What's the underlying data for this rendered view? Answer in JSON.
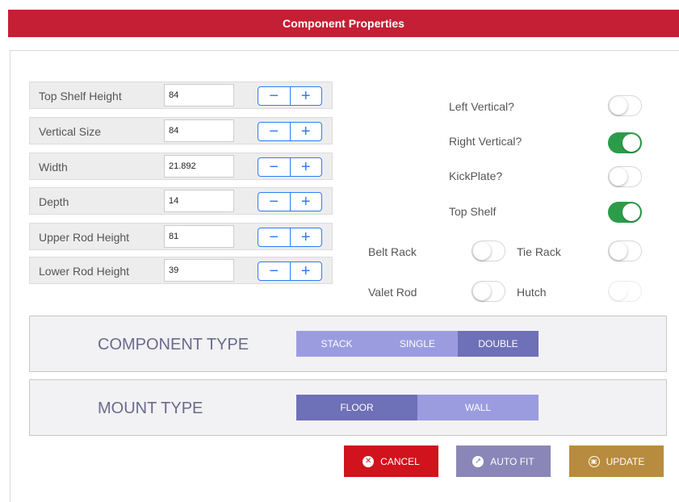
{
  "header": {
    "title": "Component Properties"
  },
  "fields": [
    {
      "label": "Top Shelf Height",
      "value": "84"
    },
    {
      "label": "Vertical Size",
      "value": "84"
    },
    {
      "label": "Width",
      "value": "21.892"
    },
    {
      "label": "Depth",
      "value": "14"
    },
    {
      "label": "Upper Rod Height",
      "value": "81"
    },
    {
      "label": "Lower Rod Height",
      "value": "39"
    }
  ],
  "stepper": {
    "minus": "−",
    "plus": "+"
  },
  "options": {
    "left_vertical": {
      "label": "Left Vertical?",
      "on": false
    },
    "right_vertical": {
      "label": "Right Vertical?",
      "on": true
    },
    "kickplate": {
      "label": "KickPlate?",
      "on": false
    },
    "top_shelf": {
      "label": "Top Shelf",
      "on": true
    },
    "belt_rack": {
      "label": "Belt Rack",
      "on": false
    },
    "tie_rack": {
      "label": "Tie Rack",
      "on": false
    },
    "valet_rod": {
      "label": "Valet Rod",
      "on": false
    },
    "hutch": {
      "label": "Hutch",
      "on": false,
      "disabled": true
    }
  },
  "component_type": {
    "title": "COMPONENT TYPE",
    "options": [
      "STACK",
      "SINGLE",
      "DOUBLE"
    ],
    "selected": "DOUBLE"
  },
  "mount_type": {
    "title": "MOUNT TYPE",
    "options": [
      "FLOOR",
      "WALL"
    ],
    "selected": "FLOOR"
  },
  "buttons": {
    "cancel": "CANCEL",
    "auto_fit": "AUTO FIT",
    "update": "UPDATE"
  },
  "colors": {
    "header": "#c41f35",
    "toggle_on": "#2b9c49",
    "stepper": "#2d7cf6",
    "segment_selected": "#6e70b8",
    "segment": "#9b9ce0",
    "cancel": "#d0131c",
    "auto_fit": "#8a86b8",
    "update": "#b88c3e"
  },
  "icons": {
    "cancel": "close-circle-icon",
    "auto_fit": "compass-icon",
    "update": "save-icon"
  }
}
